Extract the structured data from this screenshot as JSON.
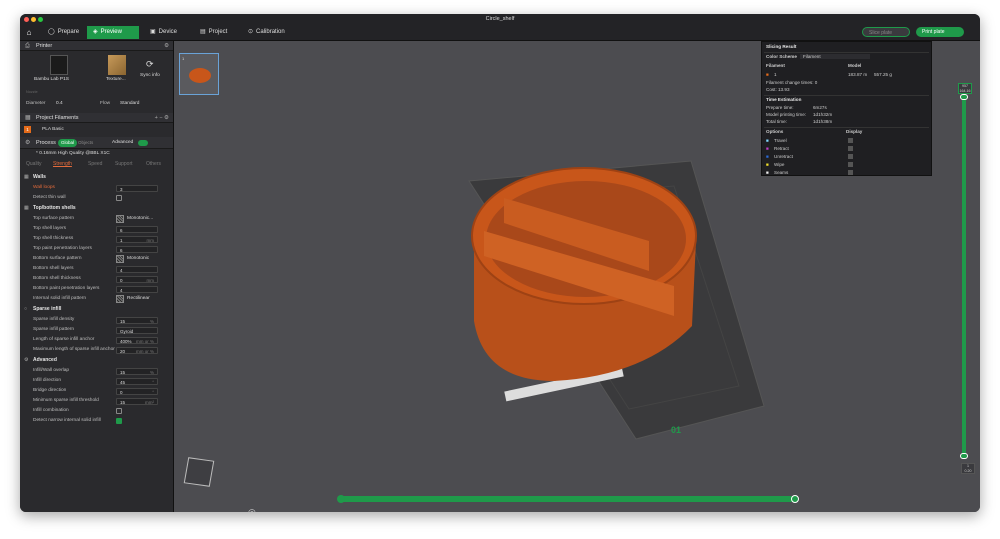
{
  "window": {
    "title": "Circle_shelf"
  },
  "toolbar": {
    "tabs": [
      {
        "label": "Prepare",
        "icon": "prepare-icon"
      },
      {
        "label": "Preview",
        "icon": "preview-icon"
      },
      {
        "label": "Device",
        "icon": "device-icon"
      },
      {
        "label": "Project",
        "icon": "project-icon"
      },
      {
        "label": "Calibration",
        "icon": "calibration-icon"
      }
    ],
    "slice_plate": "Slice plate",
    "print_plate": "Print plate"
  },
  "printer": {
    "section": "Printer",
    "name": "Bambu Lab P1S",
    "plate_label": "Texture...",
    "sync_label": "Sync info",
    "nozzle_label": "Nozzle",
    "diameter_label": "Diameter",
    "diameter_value": "0.4",
    "flow_label": "Flow",
    "flow_value": "Standard"
  },
  "filaments": {
    "section": "Project Filaments",
    "items": [
      {
        "index": "1",
        "name": "PLA Basic",
        "color": "#e46b1a"
      }
    ]
  },
  "process": {
    "section": "Process",
    "global": "Global",
    "objects": "Objects",
    "advanced": "Advanced",
    "preset": "* 0.16mm High Quality @BBL X1C",
    "tabs": [
      "Quality",
      "Strength",
      "Speed",
      "Support",
      "Others"
    ],
    "active_tab": "Strength"
  },
  "walls": {
    "title": "Walls",
    "wall_loops_label": "Wall loops",
    "wall_loops": "3",
    "thin_wall_label": "Detect thin wall"
  },
  "shells": {
    "title": "Top/bottom shells",
    "rows": [
      {
        "label": "Top surface pattern",
        "value": "Monotonic...",
        "kind": "pattern"
      },
      {
        "label": "Top shell layers",
        "value": "6",
        "kind": "num"
      },
      {
        "label": "Top shell thickness",
        "value": "1",
        "unit": "mm",
        "kind": "num"
      },
      {
        "label": "Top paint penetration layers",
        "value": "6",
        "kind": "num"
      },
      {
        "label": "Bottom surface pattern",
        "value": "Monotonic",
        "kind": "pattern"
      },
      {
        "label": "Bottom shell layers",
        "value": "4",
        "kind": "num"
      },
      {
        "label": "Bottom shell thickness",
        "value": "0",
        "unit": "mm",
        "kind": "num"
      },
      {
        "label": "Bottom paint penetration layers",
        "value": "4",
        "kind": "num"
      },
      {
        "label": "Internal solid infill pattern",
        "value": "Rectilinear",
        "kind": "pattern"
      }
    ]
  },
  "infill": {
    "title": "Sparse infill",
    "rows": [
      {
        "label": "Sparse infill density",
        "value": "15",
        "unit": "%"
      },
      {
        "label": "Sparse infill pattern",
        "value": "Gyroid"
      },
      {
        "label": "Length of sparse infill anchor",
        "value": "400%",
        "unit": "mm or %"
      },
      {
        "label": "Maximum length of sparse infill anchor",
        "value": "20",
        "unit": "mm or %"
      }
    ]
  },
  "advanced": {
    "title": "Advanced",
    "rows": [
      {
        "label": "Infill/Wall overlap",
        "value": "15",
        "unit": "%"
      },
      {
        "label": "Infill direction",
        "value": "45",
        "unit": "°"
      },
      {
        "label": "Bridge direction",
        "value": "0",
        "unit": "°"
      },
      {
        "label": "Minimum sparse infill threshold",
        "value": "15",
        "unit": "mm²"
      }
    ],
    "infill_combination": "Infill combination",
    "detect_narrow": "Detect narrow internal solid infill"
  },
  "slicing": {
    "title": "Slicing Result",
    "color_scheme_label": "Color Scheme",
    "color_scheme": "Filament",
    "filament_col": "Filament",
    "model_col": "Model",
    "filament_idx": "1",
    "filament_len": "183.87 m",
    "filament_weight": "557.25 g",
    "change_times": "Filament change times:  0",
    "cost": "Cost:   13.93",
    "time_title": "Time Estimation",
    "prepare_label": "Prepare time:",
    "prepare": "6m27s",
    "model_label": "Model printing time:",
    "model_time": "1d1h32m",
    "total_label": "Total time:",
    "total": "1d1h38m",
    "options_col": "Options",
    "display_col": "Display",
    "options": [
      {
        "name": "Travel",
        "color": "#7fd7ff"
      },
      {
        "name": "Retract",
        "color": "#c03cc8"
      },
      {
        "name": "Unretract",
        "color": "#2b6bd8"
      },
      {
        "name": "Wipe",
        "color": "#f2e02a"
      },
      {
        "name": "Seams",
        "color": "#f0f0f0"
      }
    ]
  },
  "layers": {
    "top": "957",
    "top_sub": "164.16",
    "bottom": "1",
    "bottom_sub": "0.20",
    "plate_num": "01"
  },
  "colors": {
    "accent": "#1f9a4a",
    "model": "#c8561a",
    "plate": "#3a3a3c"
  }
}
